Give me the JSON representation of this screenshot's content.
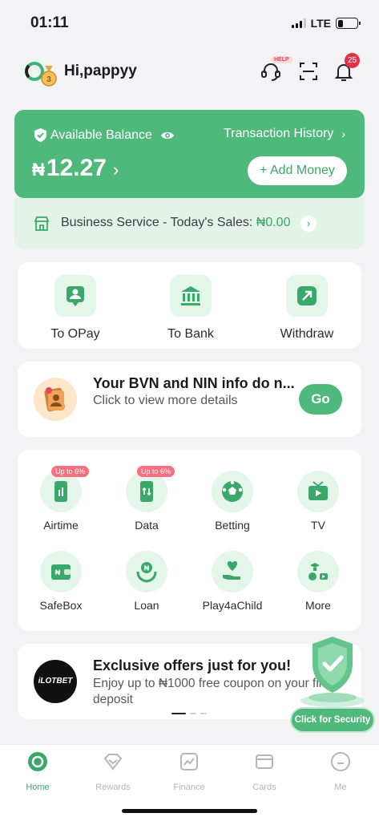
{
  "status": {
    "time": "01:11",
    "network": "LTE"
  },
  "header": {
    "greeting": "Hi,pappyy",
    "help_badge": "HELP",
    "notification_count": "25"
  },
  "balance": {
    "label": "Available Balance",
    "currency": "₦",
    "amount": "12.27",
    "transaction_history": "Transaction History",
    "add_money": "+ Add Money"
  },
  "business": {
    "text": "Business Service - Today's Sales: ",
    "sales": "₦0.00"
  },
  "transfer": [
    {
      "label": "To OPay",
      "icon": "opay-user-icon"
    },
    {
      "label": "To Bank",
      "icon": "bank-icon"
    },
    {
      "label": "Withdraw",
      "icon": "withdraw-icon"
    }
  ],
  "bvn": {
    "title": "Your BVN and NIN info do n...",
    "subtitle": "Click to view more details",
    "button": "Go"
  },
  "services": [
    {
      "label": "Airtime",
      "promo": "Up to 6%",
      "icon": "phone-airtime-icon"
    },
    {
      "label": "Data",
      "promo": "Up to 6%",
      "icon": "phone-data-icon"
    },
    {
      "label": "Betting",
      "icon": "soccer-ball-icon"
    },
    {
      "label": "TV",
      "icon": "tv-icon"
    },
    {
      "label": "SafeBox",
      "icon": "wallet-icon"
    },
    {
      "label": "Loan",
      "icon": "loan-hand-icon"
    },
    {
      "label": "Play4aChild",
      "icon": "heart-hand-icon"
    },
    {
      "label": "More",
      "icon": "more-apps-icon"
    }
  ],
  "offer": {
    "logo_text": "iLOTBET",
    "title": "Exclusive offers just for you!",
    "subtitle": "Enjoy up to ₦1000 free coupon on your first deposit"
  },
  "security": {
    "label": "Click for Security"
  },
  "tabs": [
    {
      "label": "Home",
      "active": true
    },
    {
      "label": "Rewards"
    },
    {
      "label": "Finance"
    },
    {
      "label": "Cards"
    },
    {
      "label": "Me"
    }
  ],
  "colors": {
    "brand": "#4fb87b",
    "brand_light": "#e4f5ea",
    "alert": "#e2314a"
  }
}
